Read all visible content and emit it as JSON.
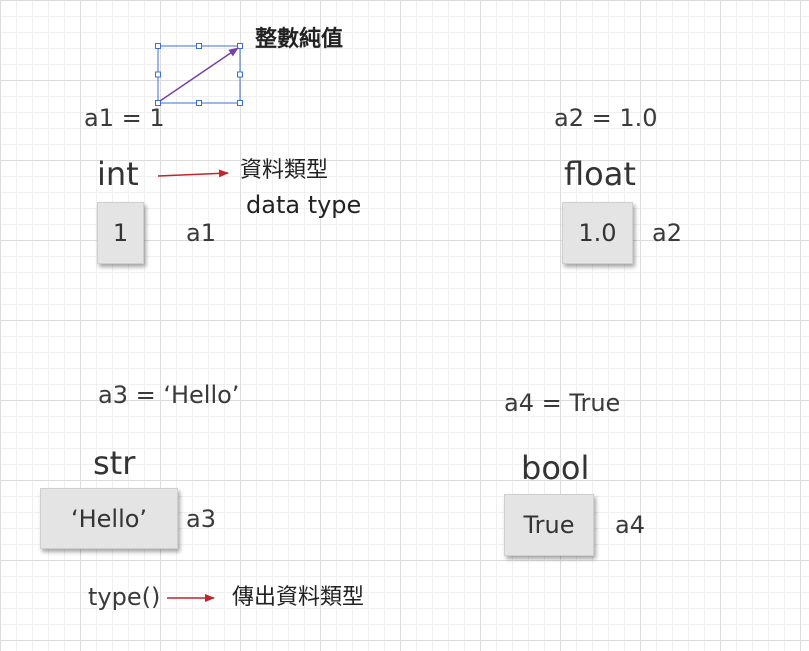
{
  "int_block": {
    "assignment": "a1 = 1",
    "type_name": "int",
    "value": "1",
    "var_label": "a1",
    "annotation_zh": "資料類型",
    "annotation_en": "data type"
  },
  "top_note": "整數純值",
  "float_block": {
    "assignment": "a2 = 1.0",
    "type_name": "float",
    "value": "1.0",
    "var_label": "a2"
  },
  "str_block": {
    "assignment": "a3 =  ‘Hello’",
    "type_name": "str",
    "value": "‘Hello’",
    "var_label": "a3"
  },
  "bool_block": {
    "assignment": "a4 =  True",
    "type_name": "bool",
    "value": "True",
    "var_label": "a4"
  },
  "type_func": {
    "label": "type()",
    "description": "傳出資料類型"
  },
  "colors": {
    "arrow_red": "#c0262e",
    "selection_blue": "#3b6fd8",
    "diag_arrow": "#7a3fa8"
  }
}
